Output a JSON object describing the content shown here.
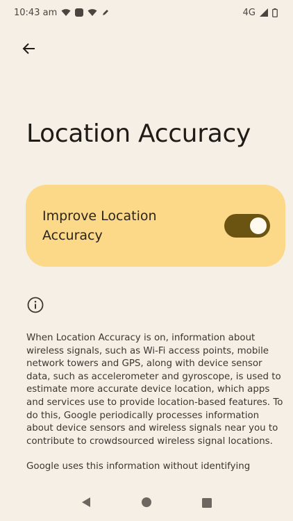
{
  "status_bar": {
    "time": "10:43 am",
    "network": "4G",
    "icons": [
      "wifi-icon",
      "app-icon",
      "wifi-icon",
      "edit-icon",
      "signal-icon",
      "battery-icon"
    ]
  },
  "header": {
    "back_icon": "arrow-left-icon"
  },
  "page": {
    "title": "Location Accuracy"
  },
  "toggle": {
    "label": "Improve Location Accuracy",
    "state": "on",
    "accent": "#fbd989",
    "track_color": "#6b5312"
  },
  "info": {
    "icon": "info-icon",
    "paragraph1": "When Location Accuracy is on, information about wireless signals, such as Wi-Fi access points, mobile network towers and GPS, along with device sensor data, such as accelerometer and gyroscope, is used to estimate more accurate device location, which apps and services use to provide location-based features. To do this, Google periodically processes information about device sensors and wireless signals near you to contribute to crowdsourced wireless signal locations.",
    "paragraph2": "Google uses this information without identifying"
  },
  "nav_bar": {
    "icons": [
      "back-triangle-icon",
      "home-circle-icon",
      "recents-square-icon"
    ]
  }
}
